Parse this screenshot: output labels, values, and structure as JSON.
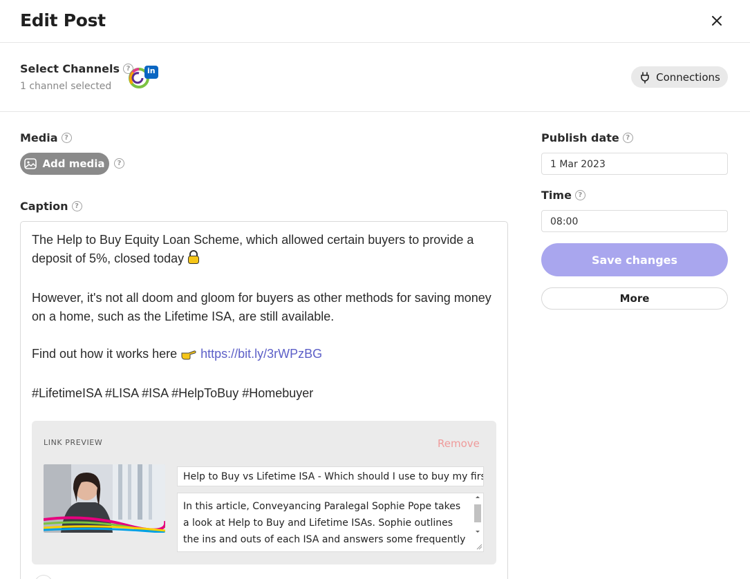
{
  "header": {
    "title": "Edit Post",
    "close_icon": "close-icon"
  },
  "channels": {
    "label": "Select Channels",
    "selected_text": "1 channel selected",
    "avatar_badge": "in",
    "connections_label": "Connections",
    "connections_icon": "plug-icon"
  },
  "media": {
    "label": "Media",
    "add_media_label": "Add media",
    "add_media_icon": "image-icon"
  },
  "caption": {
    "label": "Caption",
    "line1": "The Help to Buy Equity Loan Scheme, which allowed certain buyers to provide a deposit of 5%, closed today",
    "line1_emoji": "🔒",
    "line2": "However, it's not all doom and gloom for buyers as other methods for saving money on a home, such as the Lifetime ISA, are still available.",
    "line3": "Find out how it works here",
    "line3_emoji": "👉",
    "link": "https://bit.ly/3rWPzBG",
    "hashtags": "#LifetimeISA #LISA #ISA #HelpToBuy #Homebuyer"
  },
  "link_preview": {
    "heading": "LINK PREVIEW",
    "remove_label": "Remove",
    "title_value": "Help to Buy vs Lifetime ISA - Which should I use to buy my first home?",
    "description_value": "In this article, Conveyancing Paralegal Sophie Pope takes a look at Help to Buy and Lifetime ISAs.  Sophie outlines the ins and outs of each ISA and answers some frequently asked questions."
  },
  "schedule": {
    "publish_label": "Publish date",
    "publish_value": "1 Mar 2023",
    "time_label": "Time",
    "time_value": "08:00",
    "save_label": "Save changes",
    "more_label": "More"
  },
  "colors": {
    "accent": "#a9a6ee",
    "link": "#5c5fc7",
    "remove": "#ef9a9a",
    "linkedin": "#0a66c2"
  }
}
